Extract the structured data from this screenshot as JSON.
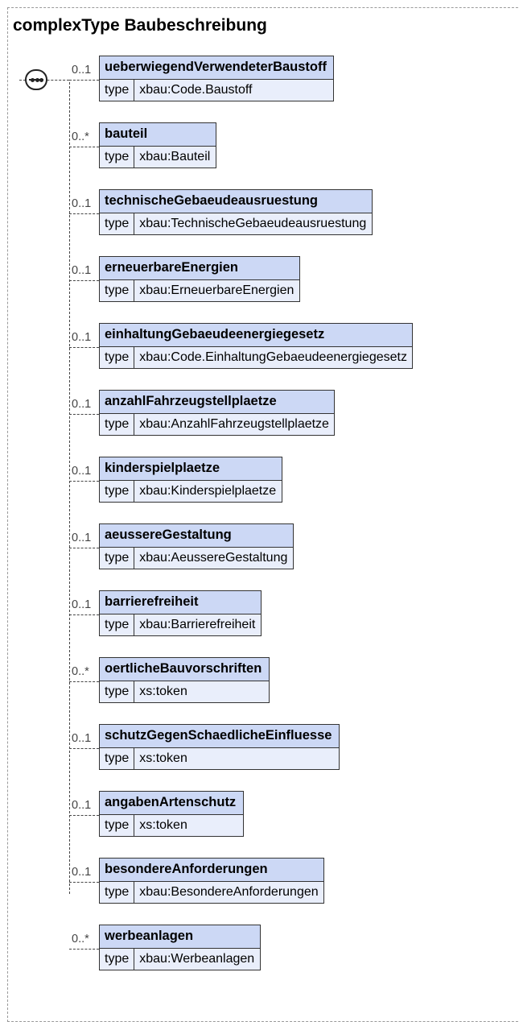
{
  "title": "complexType Baubeschreibung",
  "type_key": "type",
  "elements": [
    {
      "name": "ueberwiegendVerwendeterBaustoff",
      "cardinality": "0..1",
      "type": "xbau:Code.Baustoff"
    },
    {
      "name": "bauteil",
      "cardinality": "0..*",
      "type": "xbau:Bauteil"
    },
    {
      "name": "technischeGebaeudeausruestung",
      "cardinality": "0..1",
      "type": "xbau:TechnischeGebaeudeausruestung"
    },
    {
      "name": "erneuerbareEnergien",
      "cardinality": "0..1",
      "type": "xbau:ErneuerbareEnergien"
    },
    {
      "name": "einhaltungGebaeudeenergiegesetz",
      "cardinality": "0..1",
      "type": "xbau:Code.EinhaltungGebaeudeenergiegesetz"
    },
    {
      "name": "anzahlFahrzeugstellplaetze",
      "cardinality": "0..1",
      "type": "xbau:AnzahlFahrzeugstellplaetze"
    },
    {
      "name": "kinderspielplaetze",
      "cardinality": "0..1",
      "type": "xbau:Kinderspielplaetze"
    },
    {
      "name": "aeussereGestaltung",
      "cardinality": "0..1",
      "type": "xbau:AeussereGestaltung"
    },
    {
      "name": "barrierefreiheit",
      "cardinality": "0..1",
      "type": "xbau:Barrierefreiheit"
    },
    {
      "name": "oertlicheBauvorschriften",
      "cardinality": "0..*",
      "type": "xs:token"
    },
    {
      "name": "schutzGegenSchaedlicheEinfluesse",
      "cardinality": "0..1",
      "type": "xs:token"
    },
    {
      "name": "angabenArtenschutz",
      "cardinality": "0..1",
      "type": "xs:token"
    },
    {
      "name": "besondereAnforderungen",
      "cardinality": "0..1",
      "type": "xbau:BesondereAnforderungen"
    },
    {
      "name": "werbeanlagen",
      "cardinality": "0..*",
      "type": "xbau:Werbeanlagen"
    }
  ]
}
